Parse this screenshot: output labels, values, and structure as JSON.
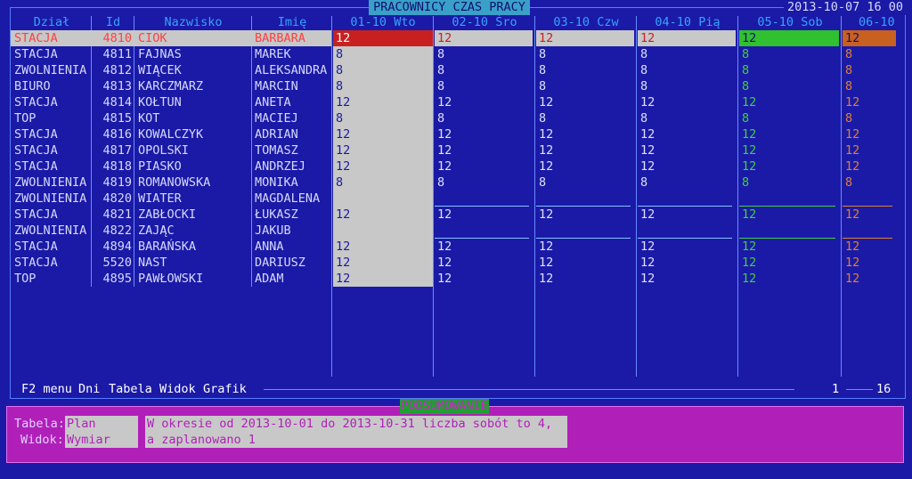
{
  "window": {
    "title": "PRACOWNICY CZAS PRACY",
    "clock": "2013-10-07 16 00"
  },
  "columns": {
    "dzial": "Dział",
    "id": "Id",
    "nazwisko": "Nazwisko",
    "imie": "Imię",
    "days": [
      "01-10 Wto",
      "02-10 Śro",
      "03-10 Czw",
      "04-10 Pią",
      "05-10 Sob",
      "06-10"
    ]
  },
  "rows": [
    {
      "dzial": "STACJA",
      "id": "4810",
      "nazwisko": "CIOK",
      "imie": "BARBARA",
      "hours": [
        "12",
        "12",
        "12",
        "12",
        "12",
        "12"
      ],
      "selected": true
    },
    {
      "dzial": "STACJA",
      "id": "4811",
      "nazwisko": "FAJNAS",
      "imie": "MAREK",
      "hours": [
        "8",
        "8",
        "8",
        "8",
        "8",
        "8"
      ]
    },
    {
      "dzial": "ZWOLNIENIA",
      "id": "4812",
      "nazwisko": "WIĄCEK",
      "imie": "ALEKSANDRA",
      "hours": [
        "8",
        "8",
        "8",
        "8",
        "8",
        "8"
      ]
    },
    {
      "dzial": "BIURO",
      "id": "4813",
      "nazwisko": "KARCZMARZ",
      "imie": "MARCIN",
      "hours": [
        "8",
        "8",
        "8",
        "8",
        "8",
        "8"
      ]
    },
    {
      "dzial": "STACJA",
      "id": "4814",
      "nazwisko": "KOŁTUN",
      "imie": "ANETA",
      "hours": [
        "12",
        "12",
        "12",
        "12",
        "12",
        "12"
      ]
    },
    {
      "dzial": "TOP",
      "id": "4815",
      "nazwisko": "KOT",
      "imie": "MACIEJ",
      "hours": [
        "8",
        "8",
        "8",
        "8",
        "8",
        "8"
      ]
    },
    {
      "dzial": "STACJA",
      "id": "4816",
      "nazwisko": "KOWALCZYK",
      "imie": "ADRIAN",
      "hours": [
        "12",
        "12",
        "12",
        "12",
        "12",
        "12"
      ]
    },
    {
      "dzial": "STACJA",
      "id": "4817",
      "nazwisko": "OPOLSKI",
      "imie": "TOMASZ",
      "hours": [
        "12",
        "12",
        "12",
        "12",
        "12",
        "12"
      ]
    },
    {
      "dzial": "STACJA",
      "id": "4818",
      "nazwisko": "PIASKO",
      "imie": "ANDRZEJ",
      "hours": [
        "12",
        "12",
        "12",
        "12",
        "12",
        "12"
      ]
    },
    {
      "dzial": "ZWOLNIENIA",
      "id": "4819",
      "nazwisko": "ROMANOWSKA",
      "imie": "MONIKA",
      "hours": [
        "8",
        "8",
        "8",
        "8",
        "8",
        "8"
      ]
    },
    {
      "dzial": "ZWOLNIENIA",
      "id": "4820",
      "nazwisko": "WIATER",
      "imie": "MAGDALENA",
      "hours": [
        "",
        "",
        "",
        "",
        "",
        ""
      ],
      "line_below": true
    },
    {
      "dzial": "STACJA",
      "id": "4821",
      "nazwisko": "ZABŁOCKI",
      "imie": "ŁUKASZ",
      "hours": [
        "12",
        "12",
        "12",
        "12",
        "12",
        "12"
      ]
    },
    {
      "dzial": "ZWOLNIENIA",
      "id": "4822",
      "nazwisko": "ZAJĄC",
      "imie": "JAKUB",
      "hours": [
        "",
        "",
        "",
        "",
        "",
        ""
      ],
      "line_below": true
    },
    {
      "dzial": "STACJA",
      "id": "4894",
      "nazwisko": "BARAŃSKA",
      "imie": "ANNA",
      "hours": [
        "12",
        "12",
        "12",
        "12",
        "12",
        "12"
      ]
    },
    {
      "dzial": "STACJA",
      "id": "5520",
      "nazwisko": "NAST",
      "imie": "DARIUSZ",
      "hours": [
        "12",
        "12",
        "12",
        "12",
        "12",
        "12"
      ]
    },
    {
      "dzial": "TOP",
      "id": "4895",
      "nazwisko": "PAWŁOWSKI",
      "imie": "ADAM",
      "hours": [
        "12",
        "12",
        "12",
        "12",
        "12",
        "12"
      ]
    }
  ],
  "menubar": {
    "f2": "F2 menu",
    "items": [
      "Dni",
      "Tabela",
      "Widok",
      "Grafik"
    ],
    "page_current": "1",
    "page_total": "16"
  },
  "summary": {
    "title": "PODSUMOWANIE",
    "tabela_label": "Tabela:",
    "tabela_value": "Plan",
    "widok_label": "Widok:",
    "widok_value": "Wymiar",
    "message_line1": "W okresie od 2013-10-01 do 2013-10-31 liczba sobót to 4,",
    "message_line2": "a zaplanowano 1"
  }
}
